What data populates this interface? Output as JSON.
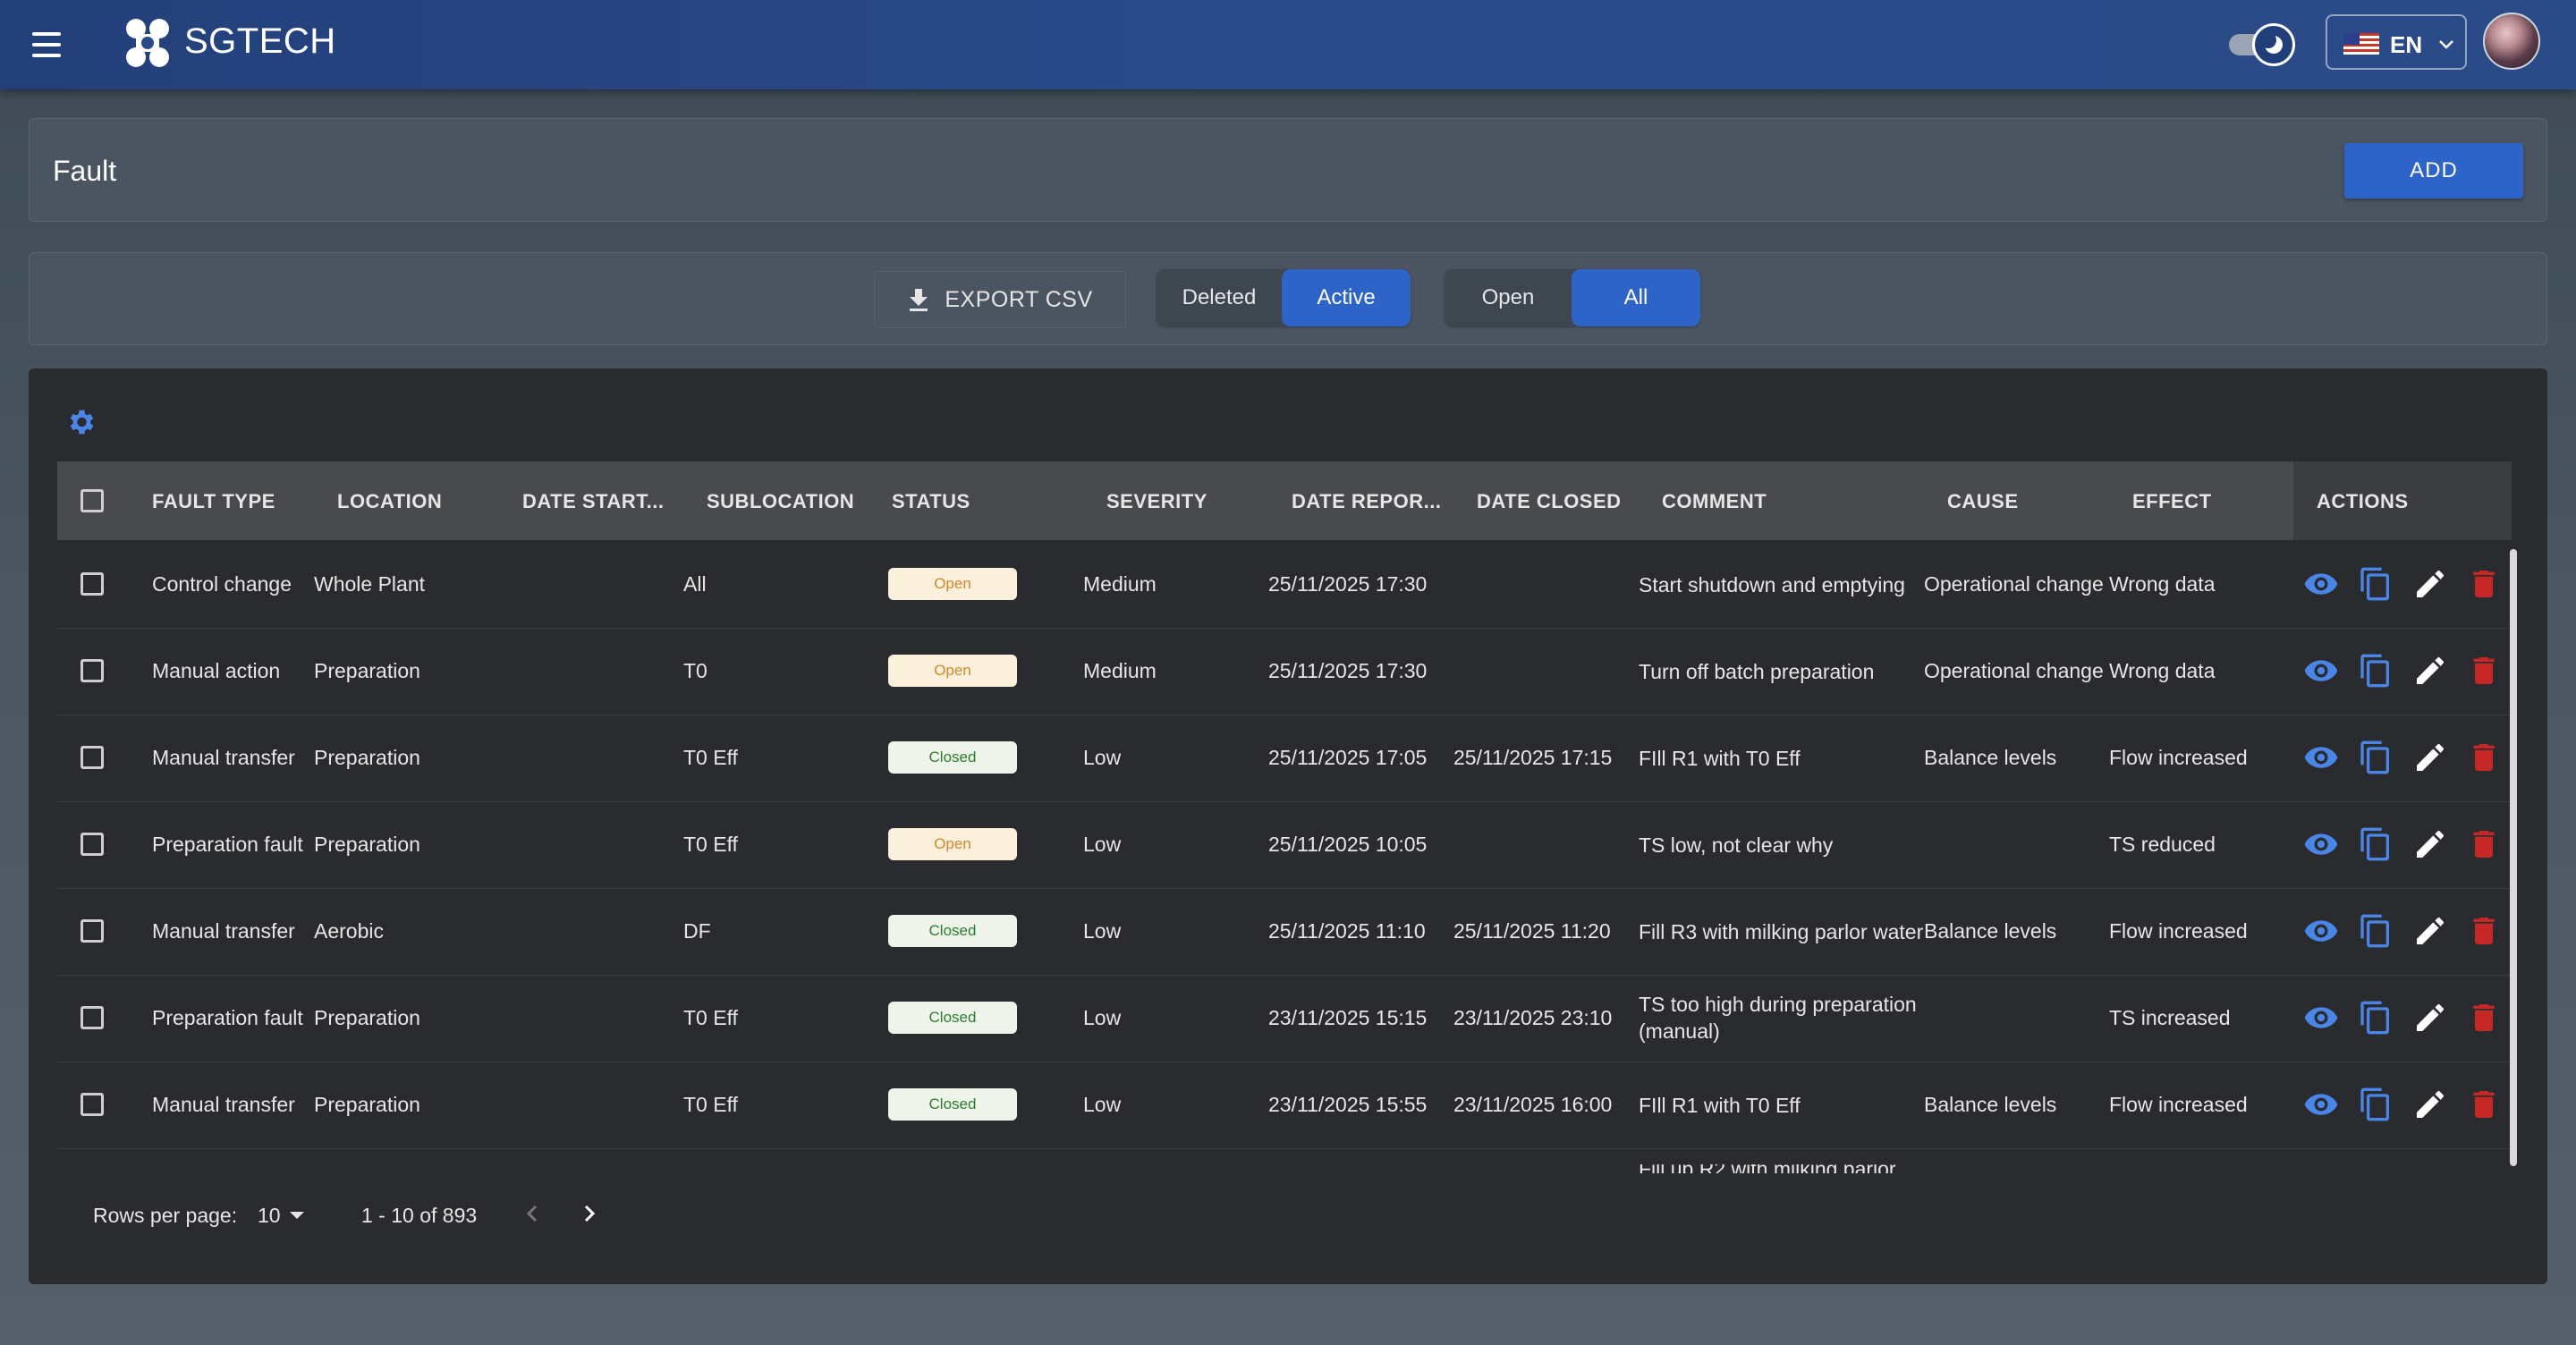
{
  "app": {
    "brand": "SGTECH",
    "language": "EN"
  },
  "header": {
    "title": "Fault",
    "add_label": "ADD"
  },
  "filters": {
    "export_label": "EXPORT CSV",
    "state_options": [
      "Deleted",
      "Active"
    ],
    "state_selected": "Active",
    "open_options": [
      "Open",
      "All"
    ],
    "open_selected": "All"
  },
  "table": {
    "columns": [
      "FAULT TYPE",
      "LOCATION",
      "DATE START...",
      "SUBLOCATION",
      "STATUS",
      "SEVERITY",
      "DATE REPOR...",
      "DATE CLOSED",
      "COMMENT",
      "CAUSE",
      "EFFECT",
      "ACTIONS"
    ],
    "rows": [
      {
        "fault_type": "Control change",
        "location": "Whole Plant",
        "date_start": "",
        "sublocation": "All",
        "status": "Open",
        "severity": "Medium",
        "date_reported": "25/11/2025 17:30",
        "date_closed": "",
        "comment": "Start shutdown and emptying",
        "cause": "Operational change",
        "effect": "Wrong data"
      },
      {
        "fault_type": "Manual action",
        "location": "Preparation",
        "date_start": "",
        "sublocation": "T0",
        "status": "Open",
        "severity": "Medium",
        "date_reported": "25/11/2025 17:30",
        "date_closed": "",
        "comment": "Turn off batch preparation",
        "cause": "Operational change",
        "effect": "Wrong data"
      },
      {
        "fault_type": "Manual transfer",
        "location": "Preparation",
        "date_start": "",
        "sublocation": "T0 Eff",
        "status": "Closed",
        "severity": "Low",
        "date_reported": "25/11/2025 17:05",
        "date_closed": "25/11/2025 17:15",
        "comment": "FIll R1 with T0 Eff",
        "cause": "Balance levels",
        "effect": "Flow increased"
      },
      {
        "fault_type": "Preparation fault",
        "location": "Preparation",
        "date_start": "",
        "sublocation": "T0 Eff",
        "status": "Open",
        "severity": "Low",
        "date_reported": "25/11/2025 10:05",
        "date_closed": "",
        "comment": "TS low, not clear why",
        "cause": "",
        "effect": "TS reduced"
      },
      {
        "fault_type": "Manual transfer",
        "location": "Aerobic",
        "date_start": "",
        "sublocation": "DF",
        "status": "Closed",
        "severity": "Low",
        "date_reported": "25/11/2025 11:10",
        "date_closed": "25/11/2025 11:20",
        "comment": "Fill R3 with milking parlor water",
        "cause": "Balance levels",
        "effect": "Flow increased"
      },
      {
        "fault_type": "Preparation fault",
        "location": "Preparation",
        "date_start": "",
        "sublocation": "T0 Eff",
        "status": "Closed",
        "severity": "Low",
        "date_reported": "23/11/2025 15:15",
        "date_closed": "23/11/2025 23:10",
        "comment": "TS too high during preparation (manual)",
        "cause": "",
        "effect": "TS increased"
      },
      {
        "fault_type": "Manual transfer",
        "location": "Preparation",
        "date_start": "",
        "sublocation": "T0 Eff",
        "status": "Closed",
        "severity": "Low",
        "date_reported": "23/11/2025 15:55",
        "date_closed": "23/11/2025 16:00",
        "comment": "FIll R1 with T0 Eff",
        "cause": "Balance levels",
        "effect": "Flow increased"
      }
    ],
    "partial_row_comment": "Fill up R2 with milking parlor"
  },
  "pagination": {
    "rows_per_page_label": "Rows per page:",
    "rows_per_page": "10",
    "range": "1 - 10 of 893"
  },
  "colors": {
    "primary": "#2e63c7",
    "appbar": "#2a4a8a",
    "open_badge": "#d1882b",
    "closed_badge": "#2e7d32",
    "delete": "#c62828",
    "view": "#4a86e8"
  },
  "icons": [
    "menu-icon",
    "logo-icon",
    "moon-icon",
    "flag-icon",
    "chevron-down-icon",
    "download-icon",
    "gear-icon",
    "eye-icon",
    "copy-icon",
    "pencil-icon",
    "trash-icon",
    "caret-down-icon",
    "chevron-left-icon",
    "chevron-right-icon"
  ]
}
